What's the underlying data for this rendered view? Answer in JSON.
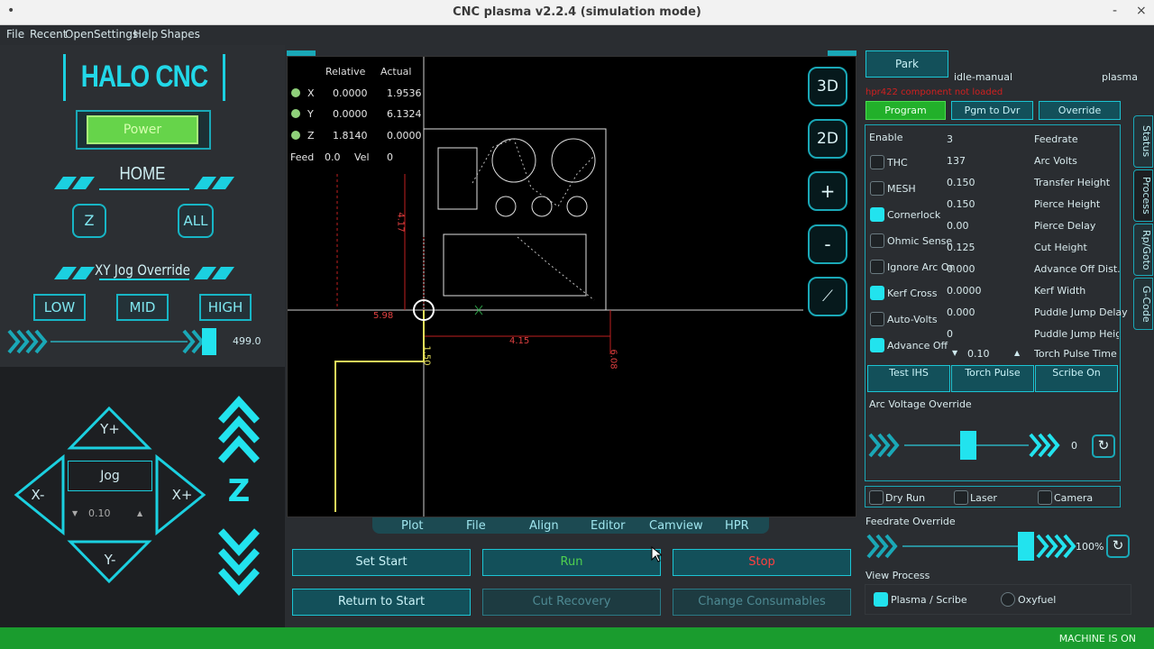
{
  "window": {
    "title": "CNC plasma v2.2.4 (simulation mode)",
    "left_control": "•",
    "minimize": "-",
    "close": "×"
  },
  "menu": [
    "File",
    "Recent",
    "Open",
    "Settings",
    "Help",
    "Shapes"
  ],
  "left": {
    "logo": "HALO CNC",
    "power": "Power",
    "home": "HOME",
    "z_button": "Z",
    "all_button": "ALL",
    "jog_override": "XY Jog Override",
    "low": "LOW",
    "mid": "MID",
    "high": "HIGH",
    "jog_speed_value": "499.0",
    "jog_label": "Jog",
    "jog_increment": "0.10",
    "yplus": "Y+",
    "yminus": "Y-",
    "xplus": "X+",
    "xminus": "X-",
    "z_axis": "Z"
  },
  "dro": {
    "relative_hdr": "Relative",
    "actual_hdr": "Actual",
    "rows": [
      {
        "axis": "X",
        "relative": "0.0000",
        "actual": "1.9536"
      },
      {
        "axis": "Y",
        "relative": "0.0000",
        "actual": "6.1324"
      },
      {
        "axis": "Z",
        "relative": "1.8140",
        "actual": "0.0000"
      }
    ],
    "feed_label": "Feed",
    "feed_value": "0.0",
    "vel_label": "Vel",
    "vel_value": "0"
  },
  "plot": {
    "dim_598": "5.98",
    "dim_417": "4.17",
    "dim_415": "4.15",
    "dim_608": "6.08",
    "dim_150": "1.50",
    "view_3d": "3D",
    "view_2d": "2D",
    "zoom_in": "+",
    "zoom_out": "-"
  },
  "tabs": [
    "Plot",
    "File",
    "Align",
    "Editor",
    "Camview",
    "HPR"
  ],
  "buttons": {
    "set_start": "Set Start",
    "run": "Run",
    "stop": "Stop",
    "return_start": "Return to Start",
    "cut_recovery": "Cut Recovery",
    "change_consumables": "Change Consumables"
  },
  "right": {
    "park": "Park",
    "state": "idle-manual",
    "mode": "plasma",
    "error": "hpr422 component not loaded",
    "program": "Program",
    "pgm_to_dvr": "Pgm to Dvr",
    "override": "Override",
    "enable": "Enable",
    "checks": [
      {
        "label": "THC",
        "on": false
      },
      {
        "label": "MESH",
        "on": false
      },
      {
        "label": "Cornerlock",
        "on": true
      },
      {
        "label": "Ohmic Sense",
        "on": false
      },
      {
        "label": "Ignore Arc On",
        "on": false
      },
      {
        "label": "Kerf Cross",
        "on": true
      },
      {
        "label": "Auto-Volts",
        "on": false
      },
      {
        "label": "Advance Off",
        "on": true
      }
    ],
    "params": [
      {
        "value": "3",
        "name": "Feedrate"
      },
      {
        "value": "137",
        "name": "Arc Volts"
      },
      {
        "value": "0.150",
        "name": "Transfer Height"
      },
      {
        "value": "0.150",
        "name": "Pierce Height"
      },
      {
        "value": "0.00",
        "name": "Pierce Delay"
      },
      {
        "value": "0.125",
        "name": "Cut Height"
      },
      {
        "value": "0.000",
        "name": "Advance Off Dist."
      },
      {
        "value": "0.0000",
        "name": "Kerf Width"
      },
      {
        "value": "0.000",
        "name": "Puddle Jump Delay"
      },
      {
        "value": "0",
        "name": "Puddle Jump Height (%"
      }
    ],
    "torch_pulse_value": "0.10",
    "torch_pulse_time": "Torch Pulse Time (sec)",
    "test_ihs": "Test IHS",
    "torch_pulse": "Torch Pulse",
    "scribe_on": "Scribe On",
    "arc_voltage_override": "Arc Voltage Override",
    "arc_override_value": "0",
    "dry_run": "Dry Run",
    "laser": "Laser",
    "camera": "Camera",
    "feedrate_override": "Feedrate Override",
    "feedrate_value": "100%",
    "view_process": "View Process",
    "plasma_scribe": "Plasma / Scribe",
    "oxyfuel": "Oxyfuel"
  },
  "sidetabs": [
    "Status",
    "Process",
    "Rp/Goto",
    "G-Code"
  ],
  "status": "MACHINE IS ON"
}
